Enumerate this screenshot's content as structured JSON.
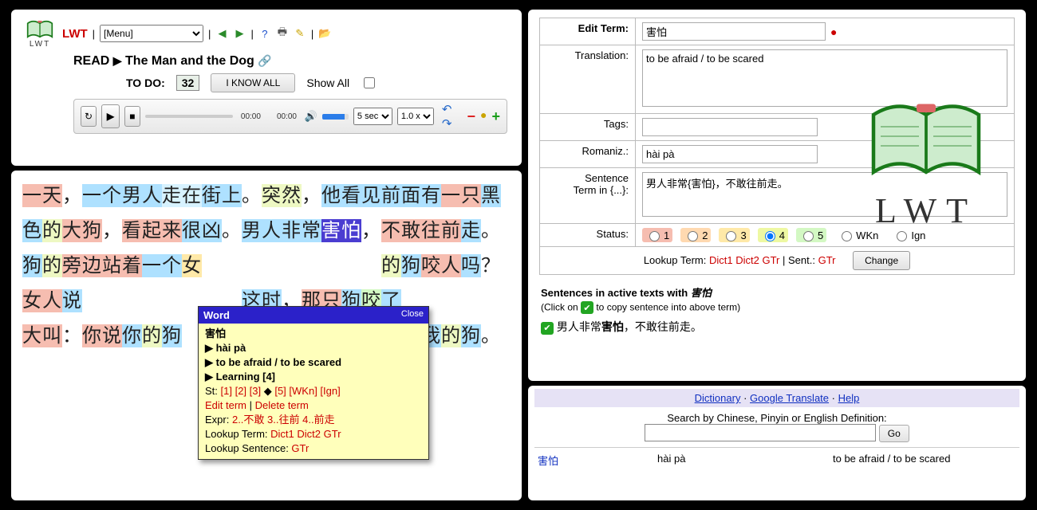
{
  "header": {
    "brand": "LWT",
    "sep": "|",
    "menu_selected": "[Menu]"
  },
  "title": {
    "prefix": "READ",
    "arrow": "▶",
    "text": "The Man and the Dog"
  },
  "todo": {
    "label": "TO DO:",
    "count": "32",
    "know_all": "I KNOW ALL",
    "show_all": "Show All"
  },
  "player": {
    "t1": "00:00",
    "t2": "00:00",
    "rewind": "5 sec",
    "speed": "1.0 x"
  },
  "popup": {
    "title": "Word",
    "close": "Close",
    "term": "害怕",
    "roman": "▶ hài pà",
    "trans": "▶ to be afraid / to be scared",
    "status": "▶ Learning [4]",
    "st_label": "St: ",
    "st_links": "[1] [2] [3]",
    "st_mid": " ◆ ",
    "st_links2": "[5] [WKn] [Ign]",
    "edit": "Edit term",
    "delbar": " | ",
    "del": "Delete term",
    "expr_label": "Expr: ",
    "expr": "2..不敢 3..往前 4..前走",
    "look_label": "Lookup Term: ",
    "d1": "Dict1",
    "d2": "Dict2",
    "gtr": "GTr",
    "looks_label": "Lookup Sentence: ",
    "gtr2": "GTr"
  },
  "form": {
    "l_term": "Edit Term:",
    "v_term": "害怕",
    "l_trans": "Translation:",
    "v_trans": "to be afraid / to be scared",
    "l_tags": "Tags:",
    "l_roman": "Romaniz.:",
    "v_roman": "hài pà",
    "l_sent": "Sentence Term in {...}:",
    "v_sent": "男人非常{害怕}，不敢往前走。",
    "l_status": "Status:",
    "s1": "1",
    "s2": "2",
    "s3": "3",
    "s4": "4",
    "s5": "5",
    "wkn": "WKn",
    "ign": "Ign",
    "lookup_label": "Lookup Term: ",
    "d1": "Dict1",
    "d2": "Dict2",
    "gtr": "GTr",
    "sent_label": " | Sent.: ",
    "gtr2": "GTr",
    "change": "Change"
  },
  "sentences": {
    "header_pre": "Sentences in active texts with ",
    "header_term": "害怕",
    "sub_pre": "(Click on ",
    "sub_post": " to copy sentence into above term)",
    "item_pre": "男人非常",
    "item_bold": "害怕",
    "item_post": "，不敢往前走。"
  },
  "biglogo": {
    "text": "LWT"
  },
  "bottom": {
    "dict": "Dictionary",
    "dot": " · ",
    "gt": "Google Translate",
    "help": "Help",
    "search_label": "Search by Chinese, Pinyin or English Definition:",
    "go": "Go",
    "res_term": "害怕",
    "res_roman": "hài pà",
    "res_trans": "to be afraid / to be scared"
  }
}
